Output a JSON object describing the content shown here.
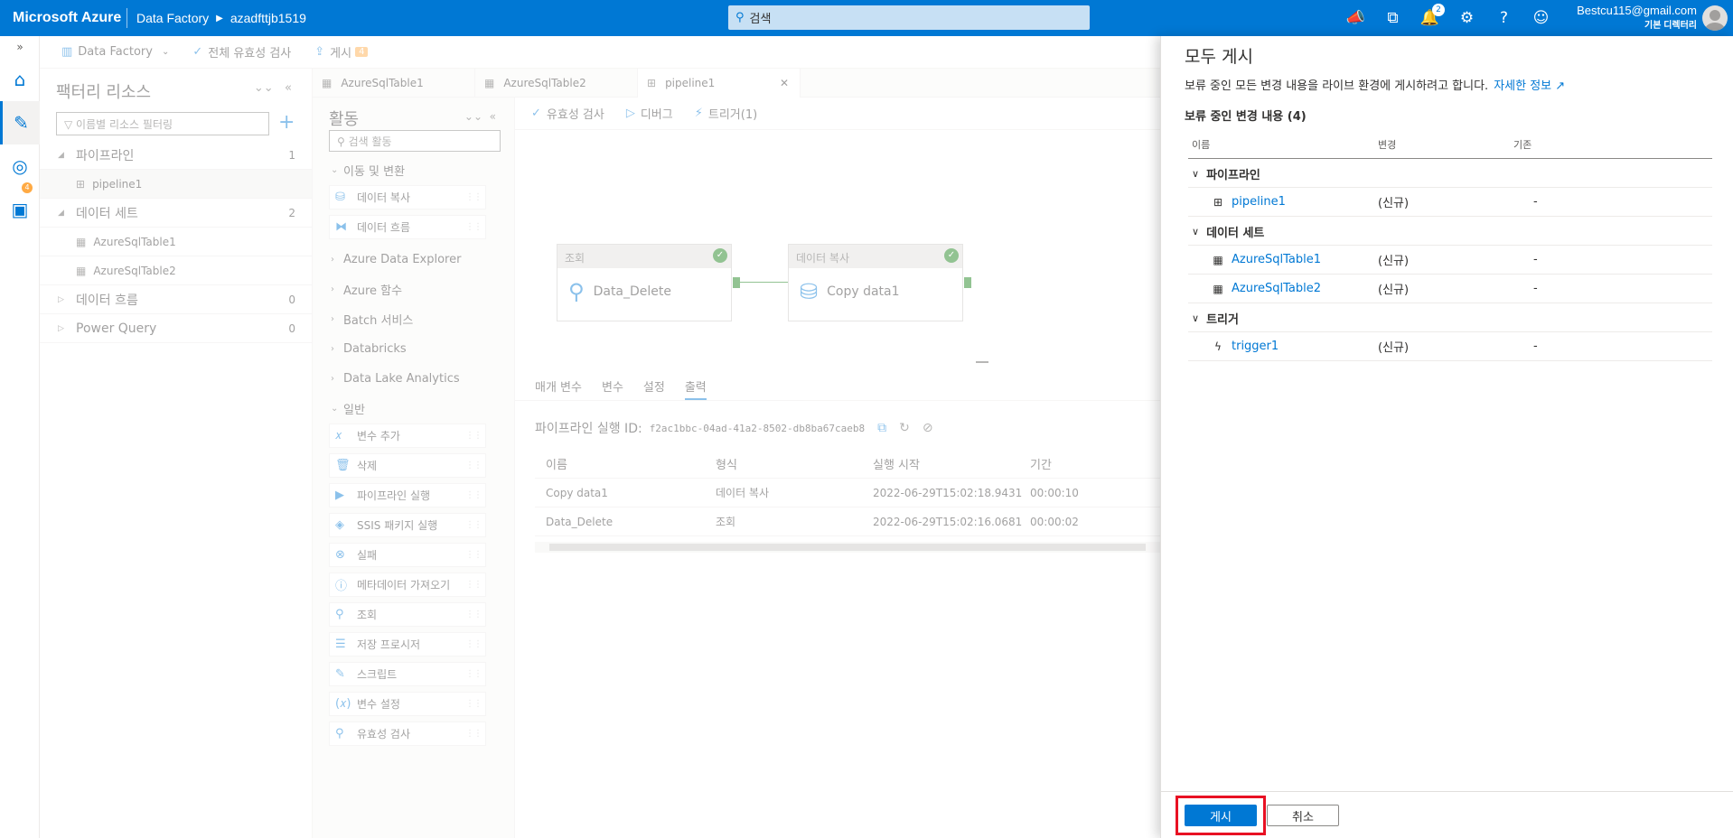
{
  "topbar": {
    "brand": "Microsoft Azure",
    "crumb1": "Data Factory",
    "crumb2": "azadfttjb1519",
    "search_placeholder": "검색",
    "notif_count": "2",
    "account_email": "Bestcu115@gmail.com",
    "account_dir": "기본 디렉터리"
  },
  "factorybar": {
    "factory_label": "Data Factory",
    "validate_all": "전체 유효성 검사",
    "publish": "게시",
    "publish_count": "4"
  },
  "rail": {
    "badge": "4"
  },
  "resources": {
    "title": "팩터리 리소스",
    "filter_placeholder": "이름별 리소스 필터링",
    "groups": [
      {
        "label": "파이프라인",
        "count": "1",
        "children": [
          "pipeline1"
        ]
      },
      {
        "label": "데이터 세트",
        "count": "2",
        "children": [
          "AzureSqlTable1",
          "AzureSqlTable2"
        ]
      },
      {
        "label": "데이터 흐름",
        "count": "0",
        "children": []
      },
      {
        "label": "Power Query",
        "count": "0",
        "children": []
      }
    ]
  },
  "tabs": [
    "AzureSqlTable1",
    "AzureSqlTable2",
    "pipeline1"
  ],
  "activities": {
    "title": "활동",
    "search_placeholder": "검색 활동",
    "cat_move": "이동 및 변환",
    "move_items": [
      "데이터 복사",
      "데이터 흐름"
    ],
    "categories": [
      "Azure Data Explorer",
      "Azure 함수",
      "Batch 서비스",
      "Databricks",
      "Data Lake Analytics"
    ],
    "cat_general": "일반",
    "general_items": [
      "변수 추가",
      "삭제",
      "파이프라인 실행",
      "SSIS 패키지 실행",
      "실패",
      "메타데이터 가져오기",
      "조회",
      "저장 프로시저",
      "스크립트",
      "변수 설정",
      "유효성 검사"
    ]
  },
  "canvas_toolbar": {
    "validate": "유효성 검사",
    "debug": "디버그",
    "trigger": "트리거(1)"
  },
  "nodes": [
    {
      "type": "조회",
      "name": "Data_Delete"
    },
    {
      "type": "데이터 복사",
      "name": "Copy data1"
    }
  ],
  "bottom": {
    "tabs": [
      "매개 변수",
      "변수",
      "설정",
      "출력"
    ],
    "run_id_label": "파이프라인 실행 ID:",
    "run_id": "f2ac1bbc-04ad-41a2-8502-db8ba67caeb8",
    "columns": [
      "이름",
      "형식",
      "실행 시작",
      "기간"
    ],
    "rows": [
      [
        "Copy data1",
        "데이터 복사",
        "2022-06-29T15:02:18.9431",
        "00:00:10"
      ],
      [
        "Data_Delete",
        "조회",
        "2022-06-29T15:02:16.0681",
        "00:00:02"
      ]
    ]
  },
  "panel": {
    "title": "모두 게시",
    "desc": "보류 중인 모든 변경 내용을 라이브 환경에 게시하려고 합니다.",
    "learn_more": "자세한 정보",
    "subtitle": "보류 중인 변경 내용 (4)",
    "col_name": "이름",
    "col_change": "변경",
    "col_base": "기존",
    "groups": [
      {
        "label": "파이프라인",
        "items": [
          {
            "name": "pipeline1",
            "change": "(신규)",
            "base": "-"
          }
        ]
      },
      {
        "label": "데이터 세트",
        "items": [
          {
            "name": "AzureSqlTable1",
            "change": "(신규)",
            "base": "-"
          },
          {
            "name": "AzureSqlTable2",
            "change": "(신규)",
            "base": "-"
          }
        ]
      },
      {
        "label": "트리거",
        "items": [
          {
            "name": "trigger1",
            "change": "(신규)",
            "base": "-"
          }
        ]
      }
    ],
    "publish_btn": "게시",
    "cancel_btn": "취소"
  }
}
